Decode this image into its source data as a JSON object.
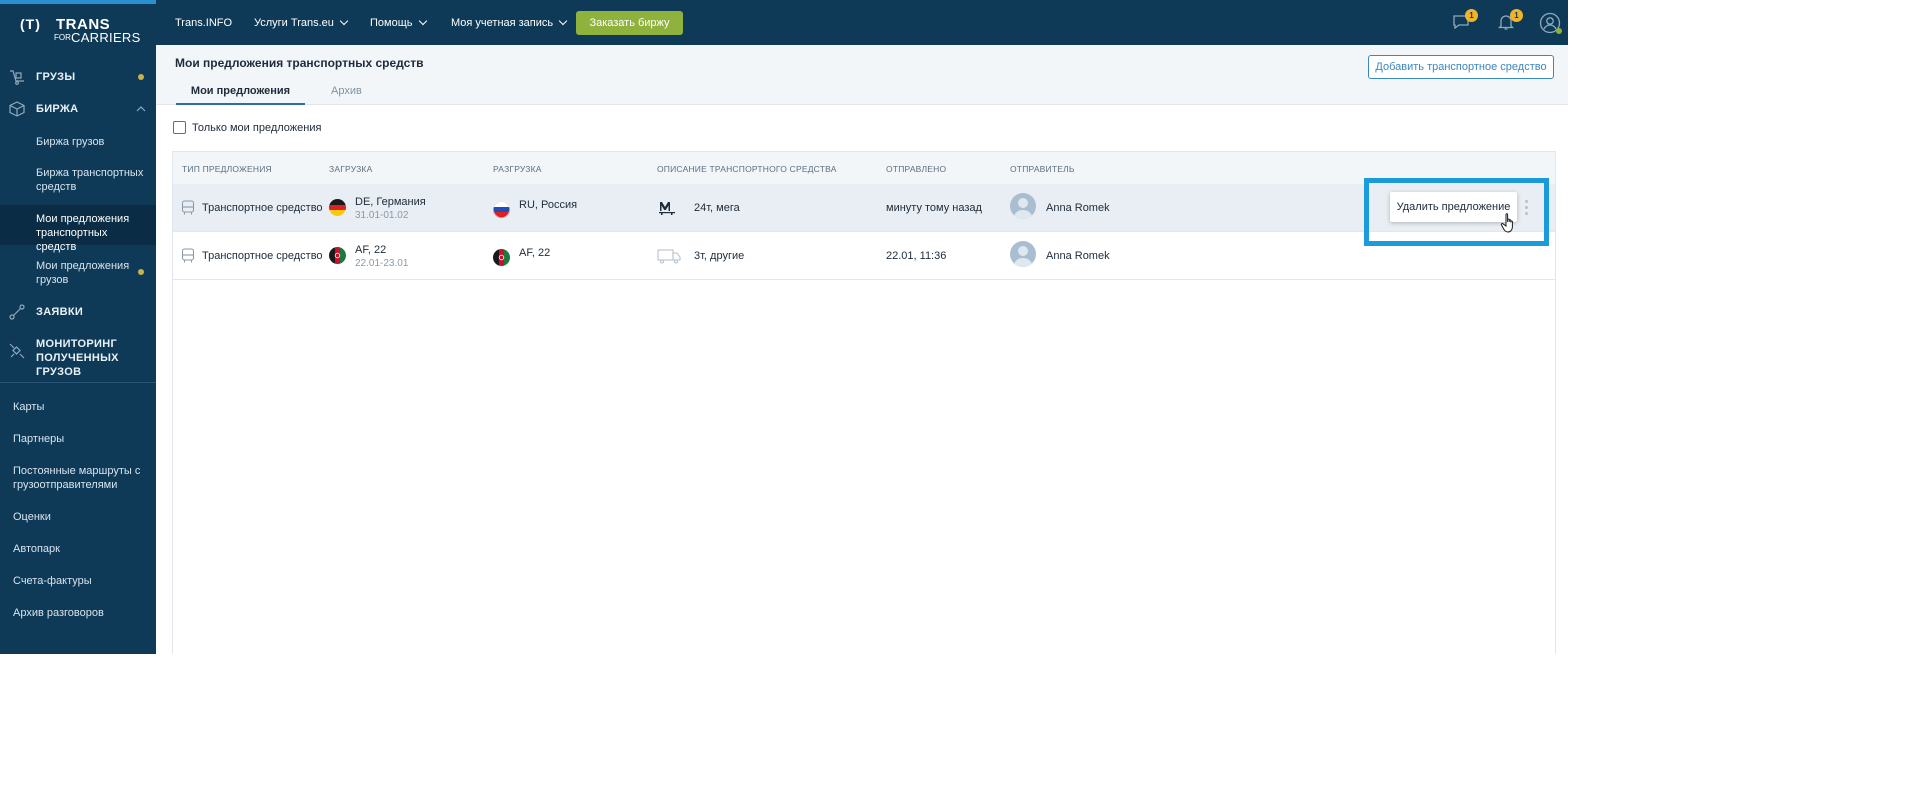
{
  "logo": {
    "mark": "(T)",
    "trans": "TRANS",
    "for": "FOR",
    "carriers": "CARRIERS"
  },
  "sidebar": {
    "items": [
      {
        "label": "ГРУЗЫ",
        "icon": "cargo-icon",
        "dot": true
      },
      {
        "label": "БИРЖА",
        "icon": "box-icon",
        "expanded": true
      },
      {
        "label": "ЗАЯВКИ",
        "icon": "route-icon"
      },
      {
        "label": "МОНИТОРИНГ ПОЛУЧЕННЫХ ГРУЗОВ",
        "icon": "satellite-icon"
      }
    ],
    "subitems": [
      {
        "label": "Биржа грузов"
      },
      {
        "label": "Биржа транспортных средств"
      },
      {
        "label": "Мои предложения транспортных средств",
        "active": true
      },
      {
        "label": "Мои предложения грузов",
        "dot": true
      }
    ],
    "links": [
      "Карты",
      "Партнеры",
      "Постоянные маршруты с грузоотправителями",
      "Оценки",
      "Автопарк",
      "Счета-фактуры",
      "Архив разговоров"
    ]
  },
  "topbar": {
    "links": [
      "Trans.INFO",
      "Услуги Trans.eu",
      "Помощь",
      "Моя учетная запись"
    ],
    "order_button": "Заказать биржу",
    "messages_badge": "1",
    "notifications_badge": "1"
  },
  "header": {
    "title": "Мои предложения транспортных средств",
    "tabs": [
      "Мои предложения",
      "Архив"
    ],
    "add_button": "Добавить транспортное средство"
  },
  "filter": {
    "label": "Только мои предложения",
    "checked": false
  },
  "table": {
    "columns": [
      "Тип предложения",
      "Загрузка",
      "Разгрузка",
      "Описание транспортного средства",
      "Отправлено",
      "Отправитель"
    ],
    "rows": [
      {
        "type": "Транспортное средство",
        "loading": "DE, Германия",
        "loading_dates": "31.01-01.02",
        "loading_flag": "de",
        "unloading": "RU, Россия",
        "unloading_flag": "ru",
        "vehicle": "24т, мега",
        "vehicle_icon": "mega-trailer-icon",
        "sent": "минуту тому назад",
        "sender": "Anna Romek"
      },
      {
        "type": "Транспортное средство",
        "loading": "AF, 22",
        "loading_dates": "22.01-23.01",
        "loading_flag": "af",
        "unloading": "AF, 22",
        "unloading_flag": "af",
        "vehicle": "3т, другие",
        "vehicle_icon": "truck-icon",
        "sent": "22.01, 11:36",
        "sender": "Anna Romek"
      }
    ]
  },
  "context_menu": {
    "delete_label": "Удалить предложение"
  },
  "colors": {
    "sidebar": "#0f3a57",
    "accent": "#8fb23c",
    "highlight": "#1a9cdc",
    "link": "#3b87c2"
  }
}
